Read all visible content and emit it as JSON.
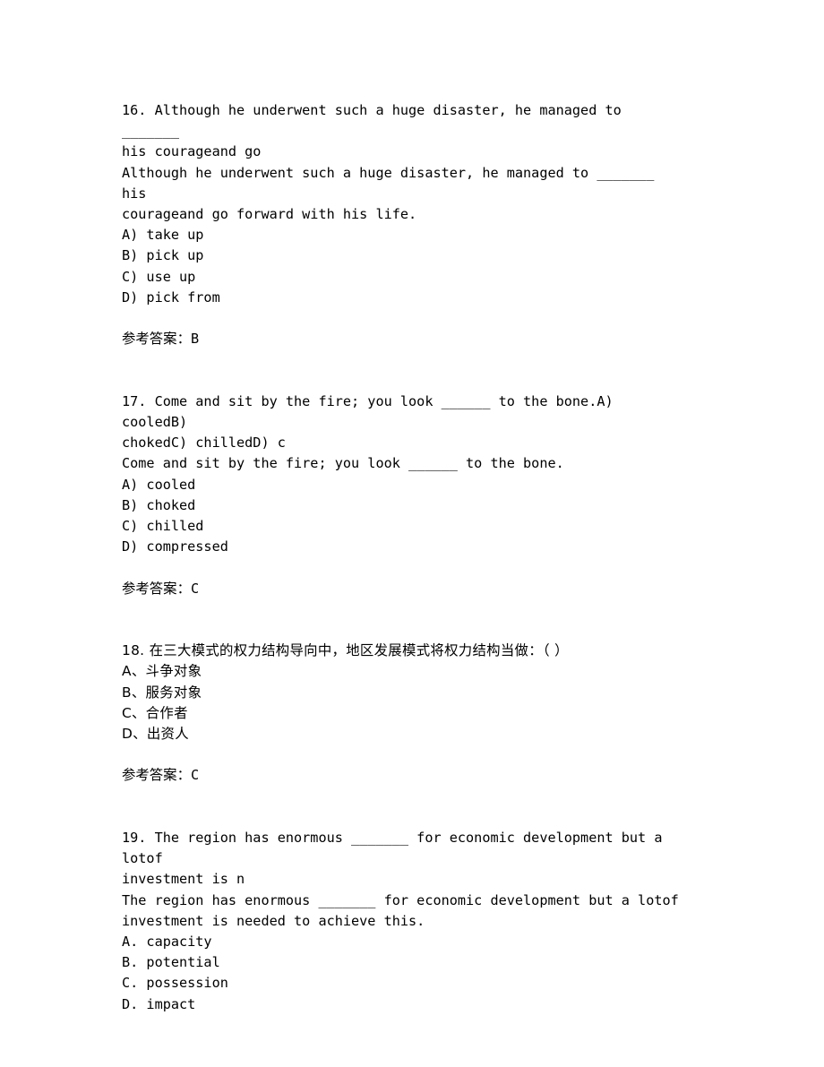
{
  "document": {
    "type": "exam-question-sheet",
    "background_color": "#ffffff",
    "text_color": "#000000",
    "answer_label": "参考答案："
  },
  "questions": [
    {
      "number": "16.",
      "header_lines": [
        "16. Although he underwent such a huge disaster, he managed to _______",
        "his courageand go"
      ],
      "stem_lines": [
        "Although he underwent such a huge disaster, he managed to _______ his",
        "courageand go forward with his life."
      ],
      "options": [
        "A) take up",
        "B) pick up",
        "C) use up",
        "D) pick from"
      ],
      "answer_label": "参考答案：",
      "answer": "B"
    },
    {
      "number": "17.",
      "header_lines": [
        "17. Come and sit by the fire; you look ______ to the bone.A) cooledB)",
        "chokedC) chilledD) c"
      ],
      "stem_lines": [
        "Come and sit by the fire; you look ______ to the bone."
      ],
      "options": [
        "A) cooled",
        "B) choked",
        "C) chilled",
        "D) compressed"
      ],
      "answer_label": "参考答案：",
      "answer": "C"
    },
    {
      "number": "18.",
      "header_lines": [
        "18. 在三大模式的权力结构导向中，地区发展模式将权力结构当做：（ ）"
      ],
      "stem_lines": [],
      "options": [
        "A、斗争对象",
        "B、服务对象",
        "C、合作者",
        "D、出资人"
      ],
      "answer_label": "参考答案：",
      "answer": "C"
    },
    {
      "number": "19.",
      "header_lines": [
        "19. The region has enormous _______ for economic development but a lotof",
        "investment is n"
      ],
      "stem_lines": [
        "The region has enormous _______ for economic development but a lotof",
        "investment is needed to achieve this."
      ],
      "options": [
        "A. capacity",
        "B. potential",
        "C. possession",
        "D. impact"
      ],
      "answer_label": "",
      "answer": ""
    }
  ]
}
